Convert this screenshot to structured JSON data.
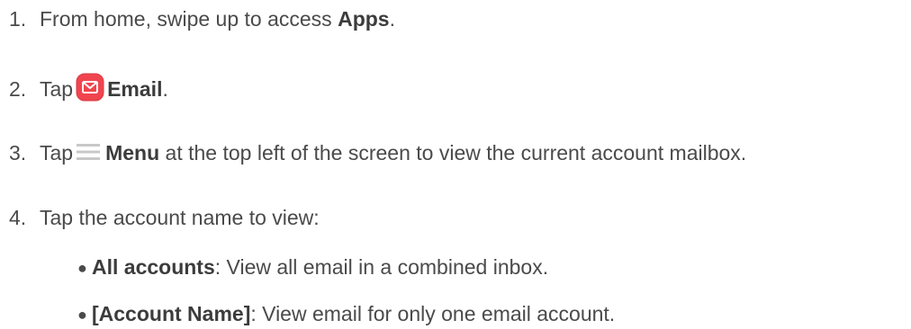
{
  "steps": [
    {
      "number": "1.",
      "text_before": "From home, swipe up to access ",
      "bold": "Apps",
      "text_after": "."
    },
    {
      "number": "2.",
      "text_before": "Tap",
      "icon": "email-app-icon",
      "bold": "Email",
      "text_after": "."
    },
    {
      "number": "3.",
      "text_before": "Tap",
      "icon": "menu-icon",
      "bold": "Menu",
      "text_after": " at the top left of the screen to view the current account mailbox."
    },
    {
      "number": "4.",
      "text": "Tap the account name to view:"
    }
  ],
  "bullets": [
    {
      "bold": "All accounts",
      "text": ": View all email in a combined inbox."
    },
    {
      "bold": "[Account Name]",
      "text": ": View email for only one email account."
    }
  ],
  "colors": {
    "text": "#4a4a4a",
    "email_icon_bg": "#f0454f",
    "menu_icon": "#c8c8c8"
  }
}
